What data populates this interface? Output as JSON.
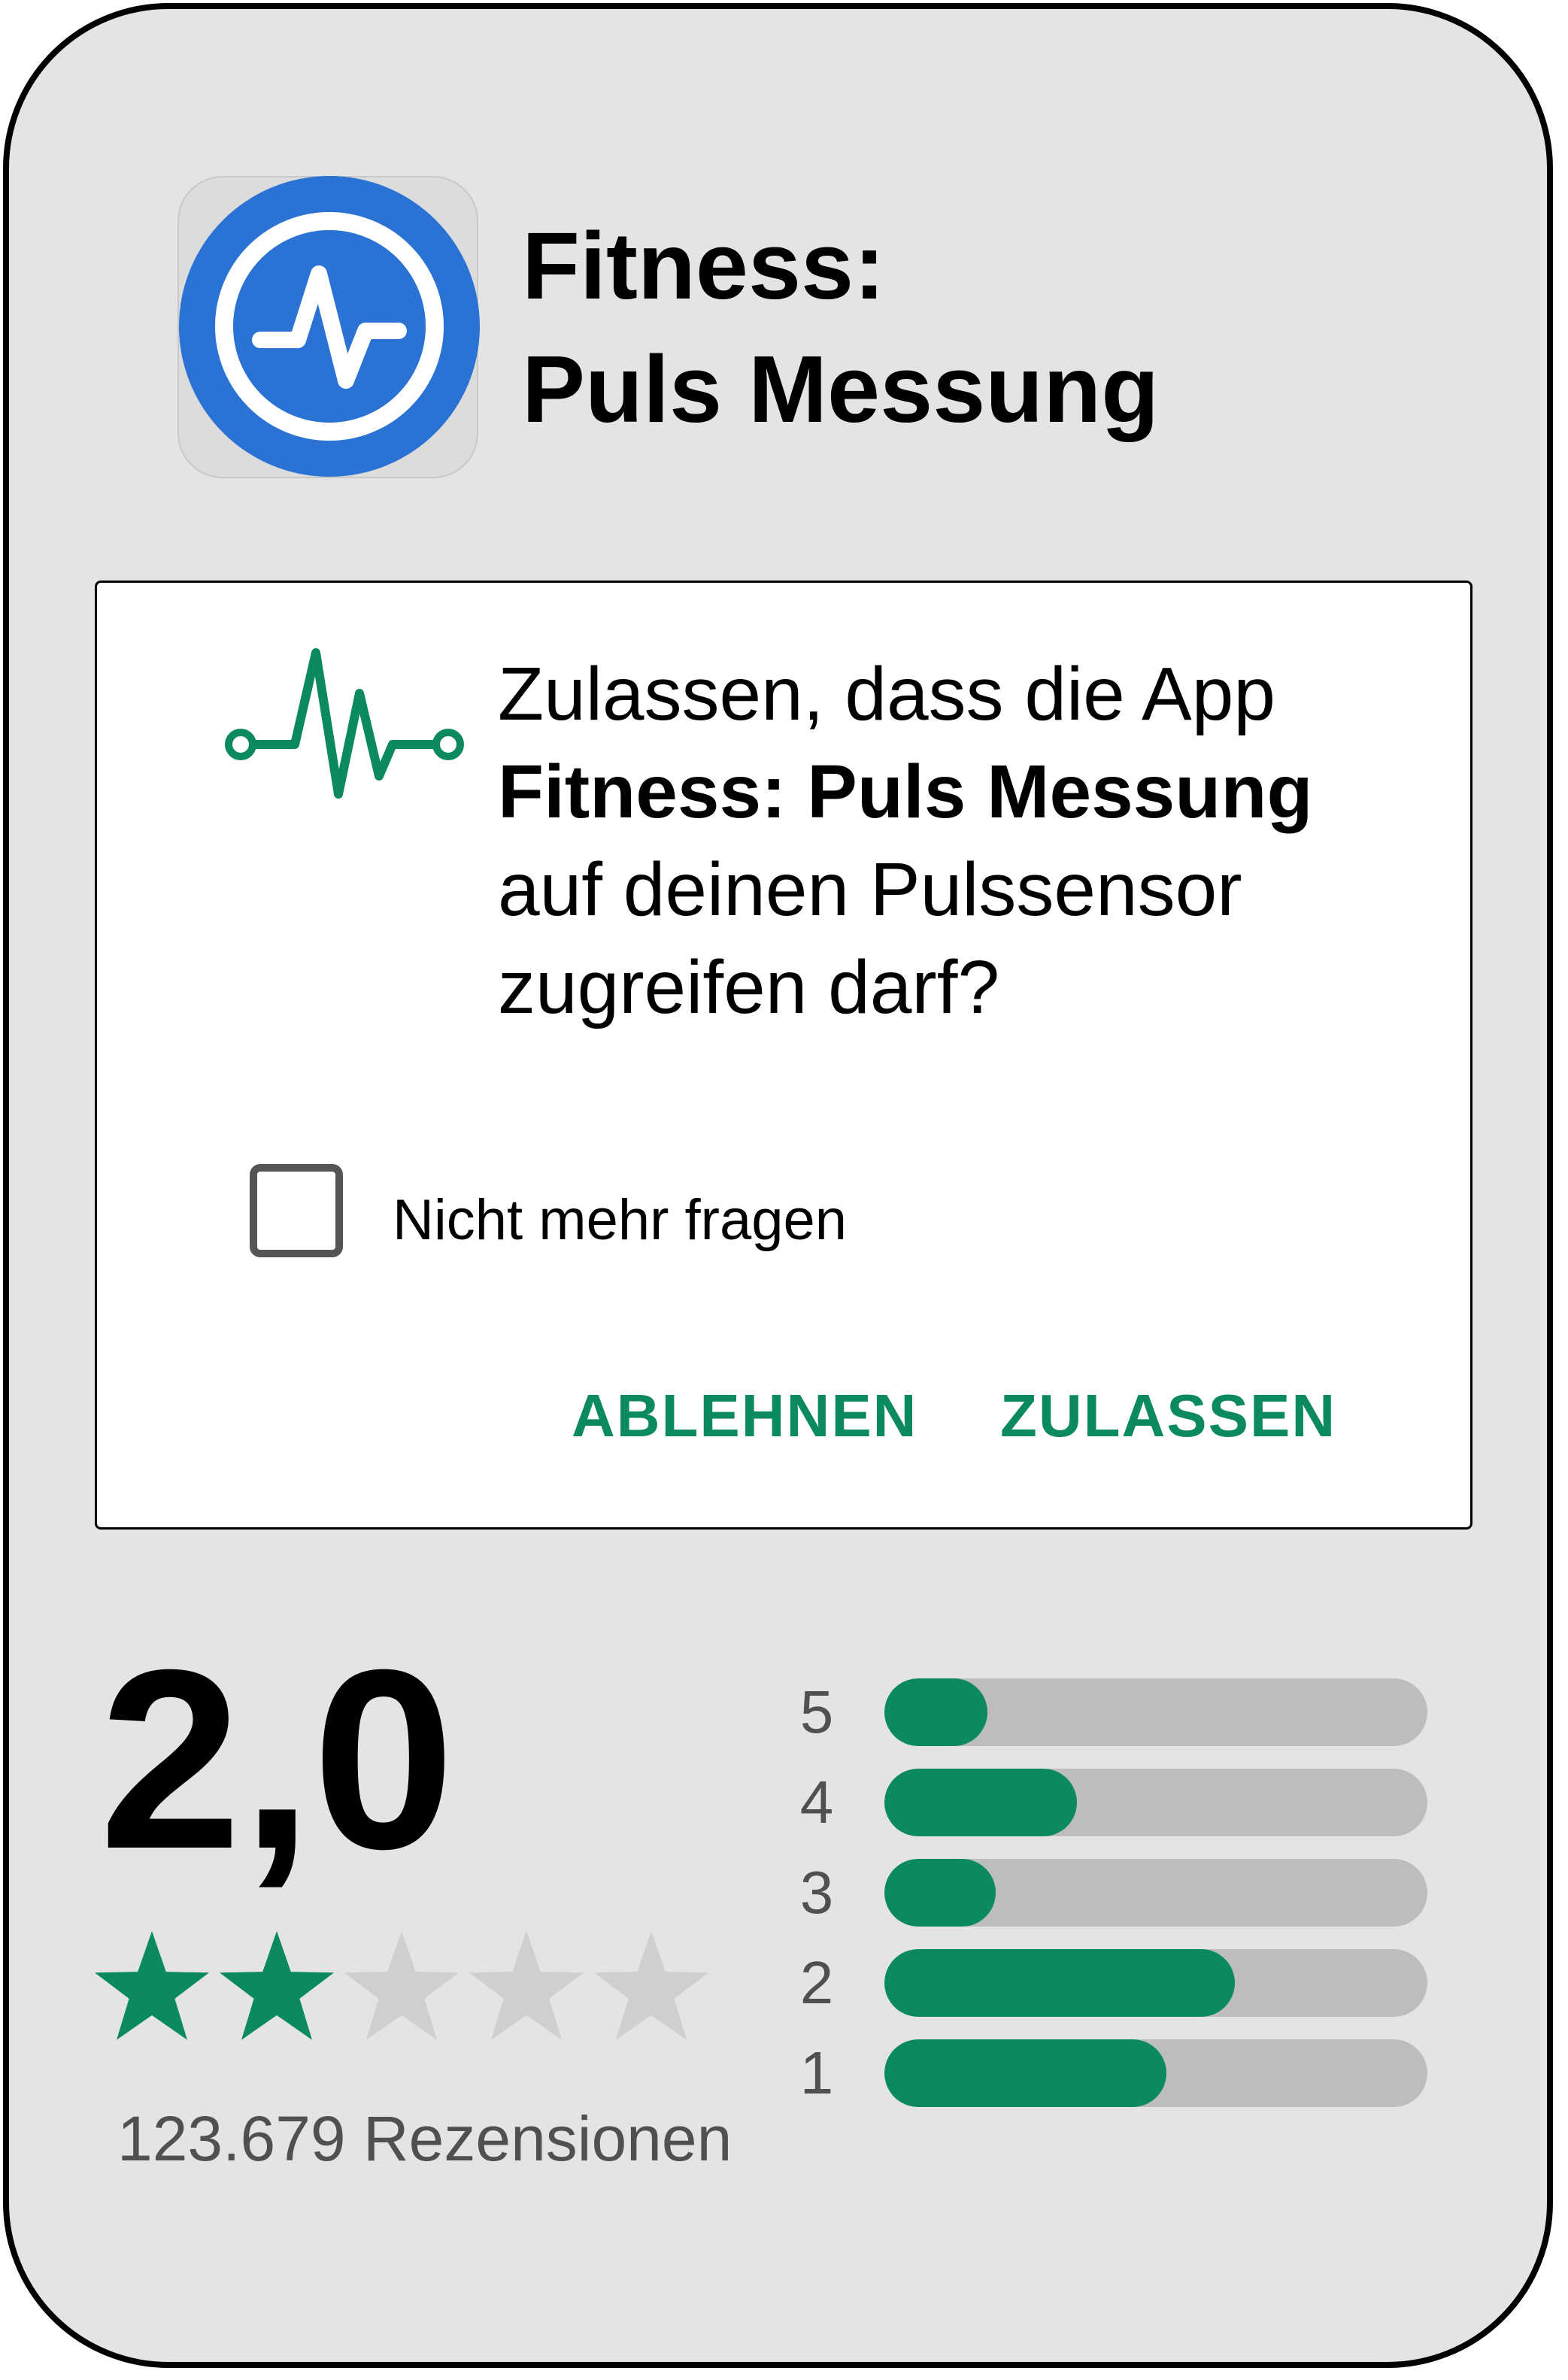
{
  "app": {
    "title_line1": "Fitness:",
    "title_line2": "Puls Messung",
    "icon": "heart-rate-pulse-icon",
    "icon_color": "#2a72d4"
  },
  "dialog": {
    "icon": "pulse-sensor-icon",
    "icon_color": "#0b8a5e",
    "text_part1": "Zulassen, dass die App ",
    "text_bold": "Fitness: Puls Messung",
    "text_part2": " auf deinen Pulssensor zugreifen darf?",
    "checkbox_label": "Nicht mehr fragen",
    "checkbox_checked": false,
    "deny_label": "ABLEHNEN",
    "allow_label": "ZULASSEN",
    "accent_color": "#0b8a5e"
  },
  "rating": {
    "score": "2,0",
    "stars_filled": 2,
    "stars_total": 5,
    "reviews": "123.679 Rezensionen",
    "distribution": [
      {
        "label": "5",
        "fraction": 0.19
      },
      {
        "label": "4",
        "fraction": 0.355
      },
      {
        "label": "3",
        "fraction": 0.205
      },
      {
        "label": "2",
        "fraction": 0.645
      },
      {
        "label": "1",
        "fraction": 0.52
      }
    ],
    "bar_color": "#0b8a5e",
    "track_color": "#bdbdbd",
    "star_filled_color": "#0b8a5e",
    "star_empty_color": "#cfcfcf"
  }
}
